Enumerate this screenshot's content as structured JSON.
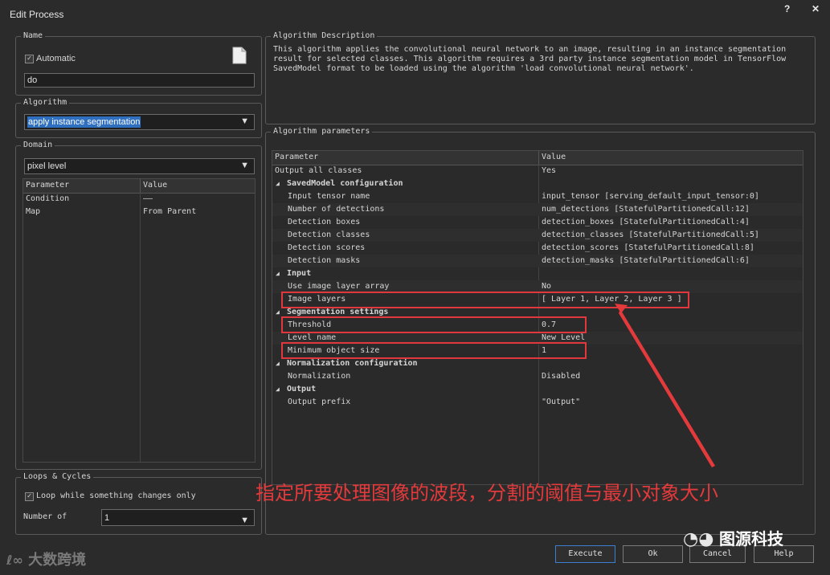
{
  "window": {
    "title": "Edit Process",
    "help_btn": "?",
    "close_btn": "✕"
  },
  "name_group": {
    "legend": "Name",
    "automatic_label": "Automatic",
    "automatic_checked": true,
    "name_value": "do"
  },
  "algorithm_group": {
    "legend": "Algorithm",
    "selected": "apply instance segmentation"
  },
  "domain_group": {
    "legend": "Domain",
    "selected": "pixel level",
    "columns": [
      "Parameter",
      "Value"
    ],
    "rows": [
      {
        "param": "Condition",
        "value": "——"
      },
      {
        "param": "Map",
        "value": "From Parent"
      }
    ]
  },
  "loops_group": {
    "legend": "Loops & Cycles",
    "loop_label": "Loop while something changes only",
    "loop_checked": true,
    "number_label": "Number of",
    "number_value": "1"
  },
  "description_group": {
    "legend": "Algorithm Description",
    "lines": [
      "This algorithm applies the convolutional neural network to an image, resulting in an instance segmentation",
      "result for selected classes. This algorithm requires a 3rd party instance segmentation model in TensorFlow",
      "SavedModel format to be loaded using the algorithm 'load convolutional neural network'."
    ]
  },
  "params_group": {
    "legend": "Algorithm parameters",
    "columns": [
      "Parameter",
      "Value"
    ],
    "rows": [
      {
        "kind": "item",
        "param": "Output all classes",
        "value": "Yes",
        "indent": 0
      },
      {
        "kind": "section",
        "param": "SavedModel configuration"
      },
      {
        "kind": "item",
        "param": "Input tensor name",
        "value": "input_tensor [serving_default_input_tensor:0]",
        "indent": 1
      },
      {
        "kind": "item",
        "param": "Number of detections",
        "value": "num_detections [StatefulPartitionedCall:12]",
        "indent": 1
      },
      {
        "kind": "item",
        "param": "Detection boxes",
        "value": "detection_boxes [StatefulPartitionedCall:4]",
        "indent": 1
      },
      {
        "kind": "item",
        "param": "Detection classes",
        "value": "detection_classes [StatefulPartitionedCall:5]",
        "indent": 1
      },
      {
        "kind": "item",
        "param": "Detection scores",
        "value": "detection_scores [StatefulPartitionedCall:8]",
        "indent": 1
      },
      {
        "kind": "item",
        "param": "Detection masks",
        "value": "detection_masks [StatefulPartitionedCall:6]",
        "indent": 1
      },
      {
        "kind": "section",
        "param": "Input"
      },
      {
        "kind": "item",
        "param": "Use image layer array",
        "value": "No",
        "indent": 1
      },
      {
        "kind": "item",
        "param": "Image layers",
        "value": "[ Layer 1, Layer 2, Layer 3 ]",
        "indent": 1
      },
      {
        "kind": "section",
        "param": "Segmentation settings"
      },
      {
        "kind": "item",
        "param": "Threshold",
        "value": "0.7",
        "indent": 1
      },
      {
        "kind": "item",
        "param": "Level name",
        "value": "New Level",
        "indent": 1
      },
      {
        "kind": "item",
        "param": "Minimum object size",
        "value": "1",
        "indent": 1
      },
      {
        "kind": "section",
        "param": "Normalization configuration"
      },
      {
        "kind": "item",
        "param": "Normalization",
        "value": "Disabled",
        "indent": 1
      },
      {
        "kind": "section",
        "param": "Output"
      },
      {
        "kind": "item",
        "param": "Output prefix",
        "value": "\"Output\"",
        "indent": 1
      }
    ]
  },
  "buttons": {
    "execute": "Execute",
    "ok": "Ok",
    "cancel": "Cancel",
    "help": "Help"
  },
  "annotation": {
    "text": "指定所要处理图像的波段，分割的阈值与最小对象大小",
    "color": "#e43a3c"
  },
  "watermarks": {
    "left": "大数跨境",
    "right": "图源科技"
  },
  "colors": {
    "background": "#2b2b2b",
    "selection": "#2f6fbf",
    "highlight_red": "#e0383c"
  }
}
